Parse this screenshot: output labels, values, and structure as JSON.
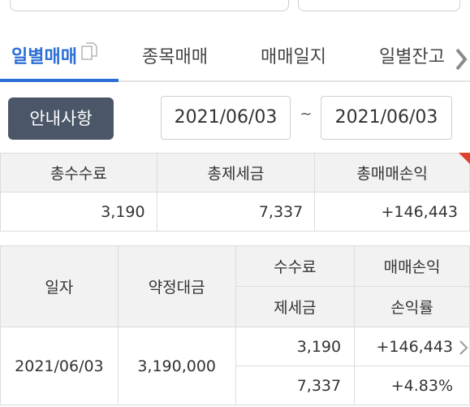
{
  "tabs": [
    {
      "label": "일별매매",
      "active": true,
      "icon": "copy-icon"
    },
    {
      "label": "종목매매",
      "active": false
    },
    {
      "label": "매매일지",
      "active": false
    },
    {
      "label": "일별잔고",
      "active": false
    }
  ],
  "controls": {
    "notice_label": "안내사항",
    "date_from": "2021/06/03",
    "separator": "~",
    "date_to": "2021/06/03"
  },
  "summary": {
    "headers": [
      "총수수료",
      "총제세금",
      "총매매손익"
    ],
    "values": [
      "3,190",
      "7,337",
      "+146,443"
    ]
  },
  "daily": {
    "headers": {
      "date": "일자",
      "amount": "약정대금",
      "fee": "수수료",
      "tax": "제세금",
      "pnl": "매매손익",
      "rate": "손익률"
    },
    "rows": [
      {
        "date": "2021/06/03",
        "amount": "3,190,000",
        "fee": "3,190",
        "tax": "7,337",
        "pnl": "+146,443",
        "rate": "+4.83%"
      }
    ]
  },
  "colors": {
    "accent": "#2d6fd6",
    "profit": "#c9302c",
    "button": "#4b5768"
  }
}
